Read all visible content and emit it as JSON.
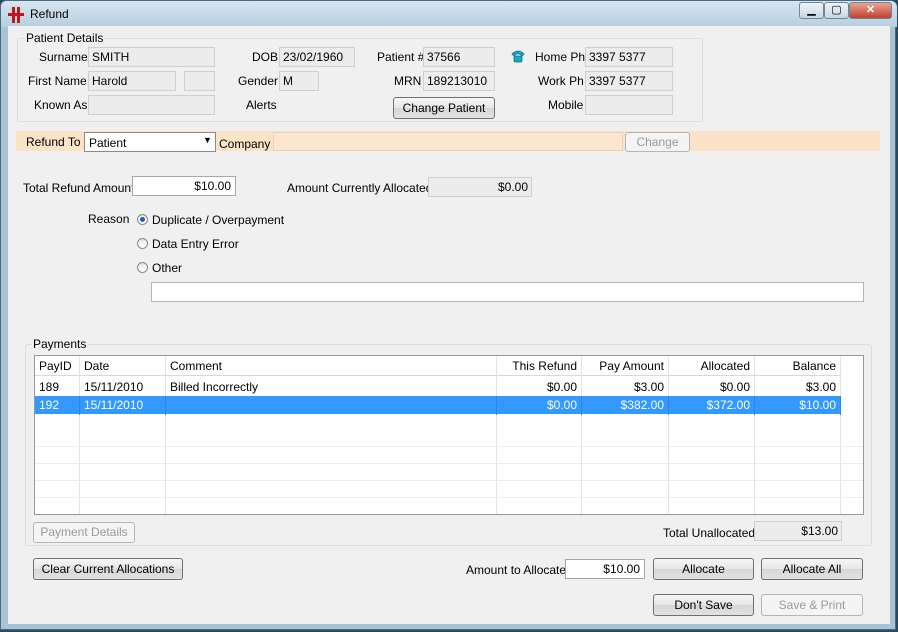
{
  "window": {
    "title": "Refund"
  },
  "patient_details": {
    "legend": "Patient Details",
    "surname_label": "Surname",
    "surname": "SMITH",
    "first_name_label": "First Name",
    "first_name": "Harold",
    "known_as_label": "Known As",
    "known_as": "",
    "dob_label": "DOB",
    "dob": "23/02/1960",
    "gender_label": "Gender",
    "gender": "M",
    "alerts_label": "Alerts",
    "patient_no_label": "Patient #",
    "patient_no": "37566",
    "mrn_label": "MRN",
    "mrn": "189213010",
    "change_patient_label": "Change Patient",
    "home_ph_label": "Home Ph",
    "home_ph": "3397 5377",
    "work_ph_label": "Work Ph",
    "work_ph": "3397 5377",
    "mobile_label": "Mobile",
    "mobile": ""
  },
  "refund_to": {
    "label": "Refund To",
    "value": "Patient",
    "company_label": "Company",
    "company": "",
    "change_label": "Change"
  },
  "amounts": {
    "total_refund_label": "Total Refund Amount",
    "total_refund": "$10.00",
    "currently_allocated_label": "Amount Currently Allocated",
    "currently_allocated": "$0.00"
  },
  "reason": {
    "label": "Reason",
    "options": [
      "Duplicate / Overpayment",
      "Data Entry Error",
      "Other"
    ],
    "selected_index": 0,
    "other_text": ""
  },
  "payments": {
    "legend": "Payments",
    "columns": [
      "PayID",
      "Date",
      "Comment",
      "This Refund",
      "Pay Amount",
      "Allocated",
      "Balance"
    ],
    "rows": [
      [
        "189",
        "15/11/2010",
        "Billed Incorrectly",
        "$0.00",
        "$3.00",
        "$0.00",
        "$3.00"
      ],
      [
        "192",
        "15/11/2010",
        "",
        "$0.00",
        "$382.00",
        "$372.00",
        "$10.00"
      ]
    ],
    "selected_row": 1,
    "payment_details_label": "Payment Details",
    "total_unallocated_label": "Total Unallocated",
    "total_unallocated": "$13.00"
  },
  "actions": {
    "clear_allocations_label": "Clear Current Allocations",
    "amount_to_allocate_label": "Amount to Allocate",
    "amount_to_allocate": "$10.00",
    "allocate_label": "Allocate",
    "allocate_all_label": "Allocate All",
    "dont_save_label": "Don't Save",
    "save_print_label": "Save & Print"
  },
  "colors": {
    "selection": "#3399ff",
    "refund_band": "#fbe3c7"
  }
}
